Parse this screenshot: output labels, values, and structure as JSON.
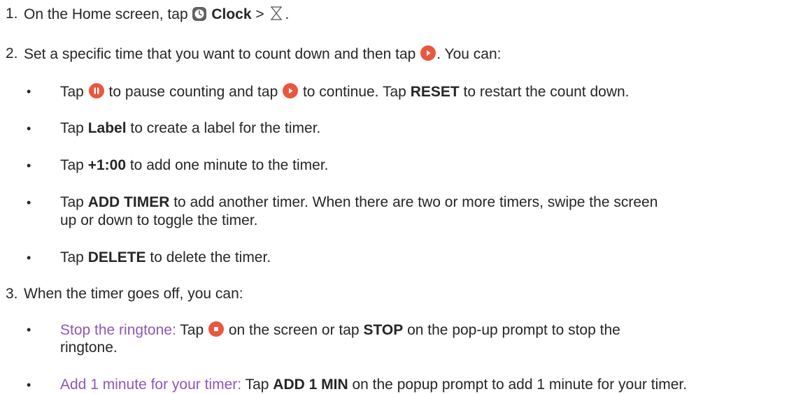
{
  "steps": [
    {
      "num": "1.",
      "pre": "On the Home screen, tap",
      "app": "Clock",
      "sep": ">",
      "end": "."
    },
    {
      "num": "2.",
      "pre": "Set a specific time that you want to count down and then tap",
      "post": ". You can:",
      "bullets": {
        "b1": {
          "t1": "Tap",
          "t2": "to pause counting and tap",
          "t3": "to continue. Tap",
          "k": "RESET",
          "t4": "to restart the count down."
        },
        "b2": {
          "t1": "Tap",
          "k": "Label",
          "t2": "to create a label for the timer."
        },
        "b3": {
          "t1": "Tap",
          "k": "+1:00",
          "t2": "to add one minute to the timer."
        },
        "b4": {
          "t1": "Tap",
          "k": "ADD TIMER",
          "t2": "to add another timer. When there are two or more timers, swipe the screen",
          "t3": "up or down to toggle the timer."
        },
        "b5": {
          "t1": "Tap",
          "k": "DELETE",
          "t2": "to delete the timer."
        }
      }
    },
    {
      "num": "3.",
      "text": "When the timer goes off, you can:",
      "bullets": {
        "b1": {
          "lead": "Stop the ringtone:",
          "t1": "Tap",
          "t2": "on the screen or tap",
          "k": "STOP",
          "t3": "on the pop-up prompt to stop the",
          "t4": "ringtone."
        },
        "b2": {
          "lead": "Add 1 minute for your timer:",
          "t1": "Tap",
          "k": "ADD 1 MIN",
          "t2": "on the popup prompt to add 1 minute for your",
          "t3": "timer."
        }
      }
    }
  ],
  "bullet_char": "•",
  "icons": [
    "clock-app-icon",
    "hourglass-icon",
    "play-icon",
    "pause-icon",
    "stop-icon"
  ],
  "colors": {
    "accent": "#e8573f",
    "link": "#8e57b5",
    "text": "#262626"
  }
}
